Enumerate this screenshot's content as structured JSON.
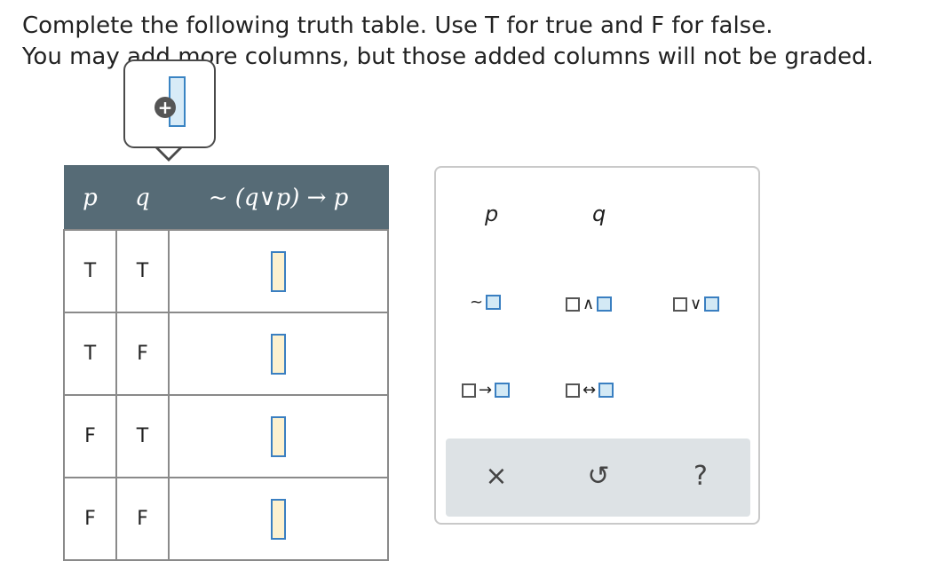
{
  "instructions": {
    "line1": "Complete the following truth table. Use T for true and F for false.",
    "line2": "You may add more columns, but those added columns will not be graded."
  },
  "add_column": {
    "icon": "plus-circle-icon"
  },
  "table": {
    "headers": [
      "p",
      "q",
      "~ (q∨p) → p"
    ],
    "rows": [
      {
        "p": "T",
        "q": "T",
        "answer": ""
      },
      {
        "p": "T",
        "q": "F",
        "answer": ""
      },
      {
        "p": "F",
        "q": "T",
        "answer": ""
      },
      {
        "p": "F",
        "q": "F",
        "answer": ""
      }
    ]
  },
  "palette": {
    "variables": [
      "p",
      "q"
    ],
    "operators": [
      {
        "name": "not",
        "symbol": "~"
      },
      {
        "name": "and",
        "symbol": "∧"
      },
      {
        "name": "or",
        "symbol": "∨"
      },
      {
        "name": "implies",
        "symbol": "→"
      },
      {
        "name": "iff",
        "symbol": "↔"
      }
    ],
    "footer": {
      "clear": "×",
      "undo": "↺",
      "help": "?"
    }
  },
  "colors": {
    "header_bg": "#566b76",
    "answer_box_border": "#3a7fc1",
    "answer_box_fill": "#fdf1cf",
    "palette_footer_bg": "#dde2e5"
  }
}
